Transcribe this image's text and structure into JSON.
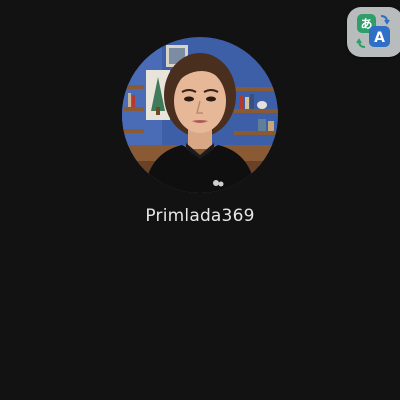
{
  "profile": {
    "username": "Primlada369",
    "avatar_icon": "profile-photo"
  },
  "toolbar": {
    "translate_icon": "translate-icon",
    "translate_icon_text": "A"
  },
  "colors": {
    "background": "#121212",
    "username_text": "#e6e6e6",
    "translate_button_bg": "#b9bcbc",
    "translate_icon_green": "#2f9e6a",
    "translate_icon_blue": "#2f6fc6"
  }
}
